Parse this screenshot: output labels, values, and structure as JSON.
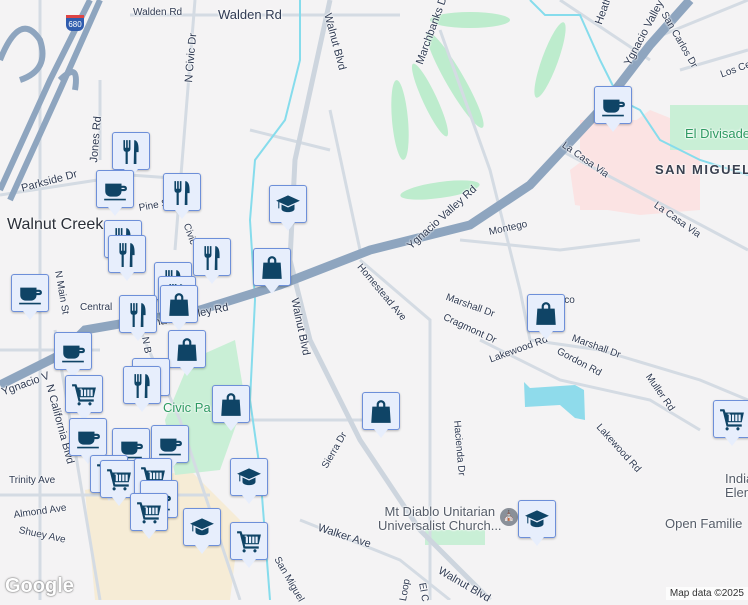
{
  "map": {
    "roads": {
      "walden_rd_1": "Walden Rd",
      "walden_rd_2": "Walden Rd",
      "n_civic_dr": "N Civic Dr",
      "walnut_blvd_north": "Walnut Blvd",
      "walnut_blvd_mid": "Walnut Blvd",
      "walnut_blvd_south": "Walnut Blvd",
      "jones_rd": "Jones Rd",
      "parkside_dr": "Parkside Dr",
      "pine_st": "Pine St",
      "civic": "Civic",
      "marchbanks_dr": "Marchbanks Dr",
      "heather": "Heath",
      "ygnacio_valley_rd_ne": "Ygnacio Valley",
      "ygnacio_valley_rd_mid": "Ygnacio Valley Rd",
      "ygnacio_valley_rd_center": "Ygnacio Valley Rd",
      "ygnacio_valley_rd_west": "Ygnacio V",
      "san_carlos_dr": "San Carlos Dr",
      "los_ce": "Los Ce",
      "la_casa_via_1": "La Casa Via",
      "la_casa_via_2": "La Casa Via",
      "montego": "Montego",
      "homestead_ave": "Homestead Ave",
      "marshall_dr_1": "Marshall Dr",
      "marshall_dr_2": "Marshall Dr",
      "cragmont_dr": "Cragmont Dr",
      "lakewood_rd_1": "Lakewood Rd",
      "lakewood_rd_2": "Lakewood Rd",
      "gordon_rd": "Gordon Rd",
      "muller_rd": "Muller Rd",
      "hacienda_dr": "Hacienda Dr",
      "sierra_dr": "Sierra Dr",
      "walker_ave": "Walker Ave",
      "san_miguel": "San Miguel",
      "loop": "Loop",
      "el_c": "El C",
      "central": "Central",
      "n_main_st": "N Main St",
      "n_california_blvd": "N California Blvd",
      "trinity_ave": "Trinity Ave",
      "almond_ave": "Almond Ave",
      "shuey_ave": "Shuey Ave",
      "n_b": "N B",
      "pico": "ico",
      "highway_shield": "680"
    },
    "places": {
      "walnut_creek": "Walnut Creek",
      "san_miguel": "SAN MIGUEL",
      "el_divisadero": "El Divisade",
      "civic_park": "Civic Pa",
      "church_line1": "Mt Diablo Unitarian",
      "church_line2": "Universalist Church...",
      "indian_line1": "India",
      "indian_line2": "Elementa",
      "open_families": "Open Familie"
    },
    "markers": [
      "restaurant",
      "coffee",
      "restaurant",
      "school",
      "restaurant",
      "restaurant",
      "restaurant",
      "shopping",
      "restaurant",
      "restaurant",
      "coffee",
      "restaurant",
      "shopping",
      "shopping",
      "coffee",
      "restaurant",
      "restaurant",
      "cart",
      "shopping",
      "coffee",
      "coffee",
      "coffee",
      "cart",
      "cart",
      "cart",
      "coffee",
      "cart",
      "school",
      "school",
      "cart",
      "shopping",
      "shopping",
      "coffee",
      "cart",
      "school"
    ],
    "logo": "Google",
    "attribution": "Map data ©2025"
  }
}
